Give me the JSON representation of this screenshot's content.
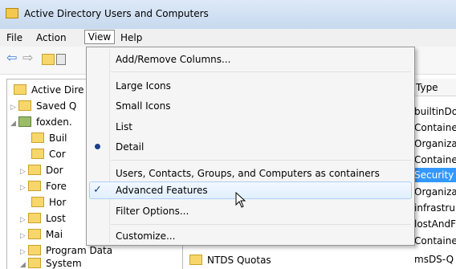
{
  "window": {
    "title": "Active Directory Users and Computers"
  },
  "menubar": {
    "items": [
      "File",
      "Action",
      "View",
      "Help"
    ]
  },
  "tree": {
    "root": "Active Dire",
    "saved": "Saved Q",
    "domain": "foxden.",
    "children": [
      "Buil",
      "Cor",
      "Dor",
      "Fore",
      "Hor",
      "Lost",
      "Mai",
      "Program Data",
      "System"
    ]
  },
  "list": {
    "type_header": "Type",
    "types": [
      "builtinDo",
      "Containe",
      "Organiza",
      "Containe",
      "Security",
      "Organiza",
      "infrastru",
      "lostAndF",
      "Containe",
      "msDS-Q"
    ],
    "bottom_item_name": "NTDS Quotas"
  },
  "view_menu": {
    "add_remove_columns": "Add/Remove Columns...",
    "large_icons": "Large Icons",
    "small_icons": "Small Icons",
    "list": "List",
    "detail": "Detail",
    "containers": "Users, Contacts, Groups, and Computers as containers",
    "advanced_features": "Advanced Features",
    "filter_options": "Filter Options...",
    "customize": "Customize..."
  },
  "colors": {
    "selection": "#3399ff",
    "menu_highlight_border": "#aecff7"
  }
}
